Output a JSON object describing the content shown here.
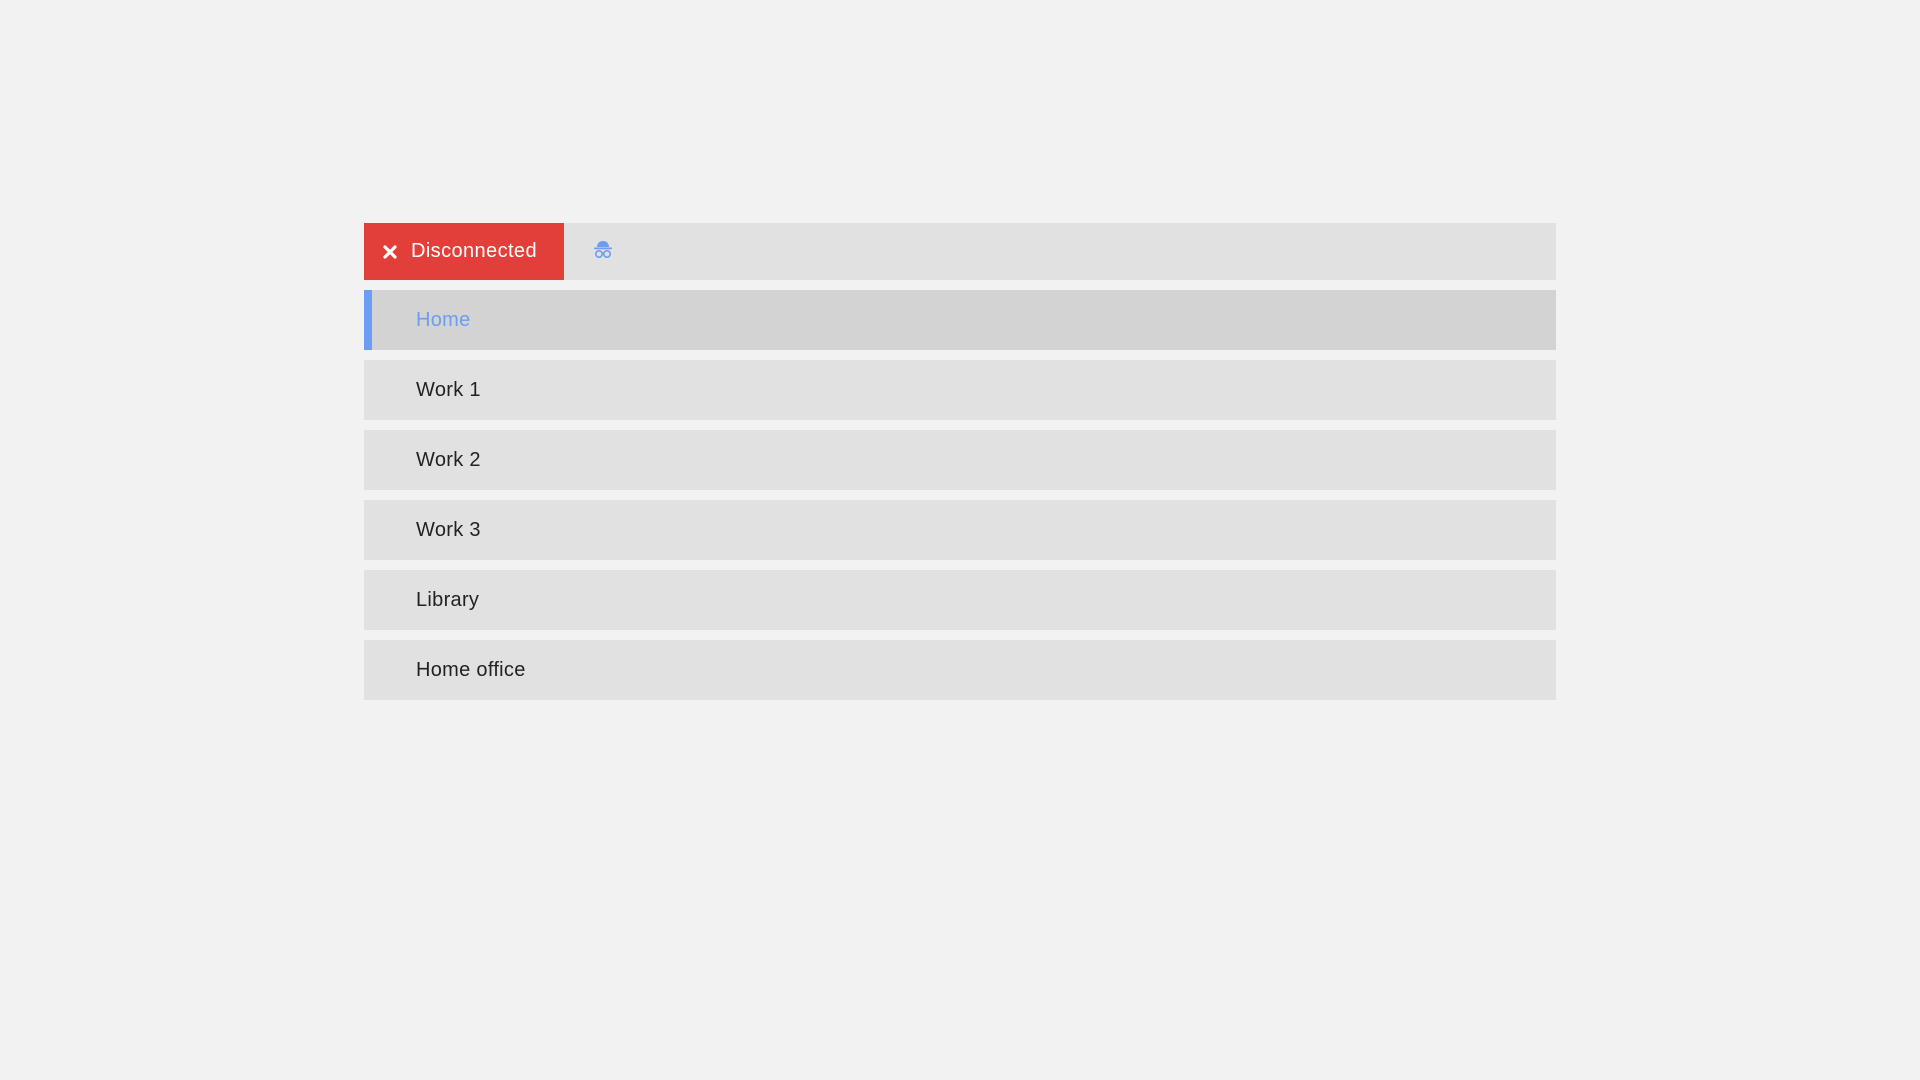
{
  "status": {
    "label": "Disconnected",
    "icon": "close-icon",
    "color": "#e23e3a"
  },
  "incognito": {
    "icon": "incognito-icon",
    "color": "#6d9cf3"
  },
  "networks": [
    {
      "label": "Home",
      "selected": true
    },
    {
      "label": "Work 1",
      "selected": false
    },
    {
      "label": "Work 2",
      "selected": false
    },
    {
      "label": "Work 3",
      "selected": false
    },
    {
      "label": "Library",
      "selected": false
    },
    {
      "label": "Home office",
      "selected": false
    }
  ],
  "colors": {
    "accent": "#6d9cf3",
    "item_bg": "#e1e1e1",
    "selected_bg": "#d3d3d3",
    "page_bg": "#f2f2f2"
  }
}
